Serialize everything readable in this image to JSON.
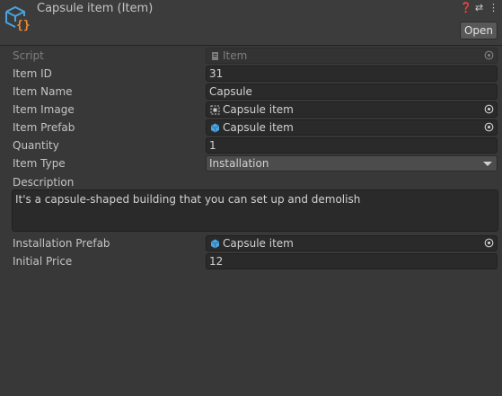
{
  "header": {
    "title": "Capsule item (Item)",
    "open_label": "Open",
    "icons": [
      "help-icon",
      "preset-icon",
      "more-menu-icon"
    ]
  },
  "fields": {
    "script": {
      "label": "Script",
      "value": "Item"
    },
    "item_id": {
      "label": "Item ID",
      "value": "31"
    },
    "item_name": {
      "label": "Item Name",
      "value": "Capsule"
    },
    "item_image": {
      "label": "Item Image",
      "value": "Capsule item"
    },
    "item_prefab": {
      "label": "Item Prefab",
      "value": "Capsule item"
    },
    "quantity": {
      "label": "Quantity",
      "value": "1"
    },
    "item_type": {
      "label": "Item Type",
      "value": "Installation"
    },
    "description": {
      "label": "Description",
      "value": "It's a capsule-shaped building that you can set up and demolish"
    },
    "installation_prefab": {
      "label": "Installation Prefab",
      "value": "Capsule item"
    },
    "initial_price": {
      "label": "Initial Price",
      "value": "12"
    }
  },
  "colors": {
    "background": "#383838",
    "field": "#2a2a2a",
    "asset_icon_blue": "#4aa3e0",
    "asset_icon_orange": "#f08a30"
  }
}
